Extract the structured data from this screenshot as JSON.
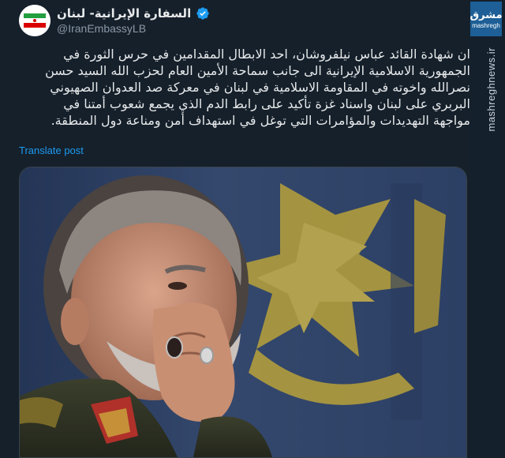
{
  "tweet": {
    "author_name": "السفارة الإيرانية- لبنان",
    "handle": "@IranEmbassyLB",
    "text_lines": [
      "ان شهادة القائد عباس نيلفروشان، احد الابطال المقدامين في حرس الثورة في",
      "الجمهورية الاسلامية الإيرانية الى جانب سماحة الأمين العام لحزب الله السيد حسن",
      "نصرالله واخوته في المقاومة الاسلامية في لبنان في معركة صد العدوان الصهيوني",
      "البربري على لبنان واسناد غزة تأكيد على رابط الدم الذي يجمع شعوب أمتنا في",
      "مواجهة التهديدات والمؤامرات التي توغل في استهداف أمن ومناعة دول المنطقة."
    ],
    "translate_label": "Translate post"
  },
  "watermark": {
    "logo_ar": "مشرق",
    "logo_en": "mashregh",
    "site": "mashreghnews.ir"
  },
  "colors": {
    "background": "#15202b",
    "text": "#e7e9ea",
    "secondary": "#8b98a5",
    "link": "#1d9bf0",
    "verified": "#1d9bf0"
  },
  "icons": {
    "verified": "verified-badge-icon",
    "avatar": "iran-flag-avatar"
  }
}
